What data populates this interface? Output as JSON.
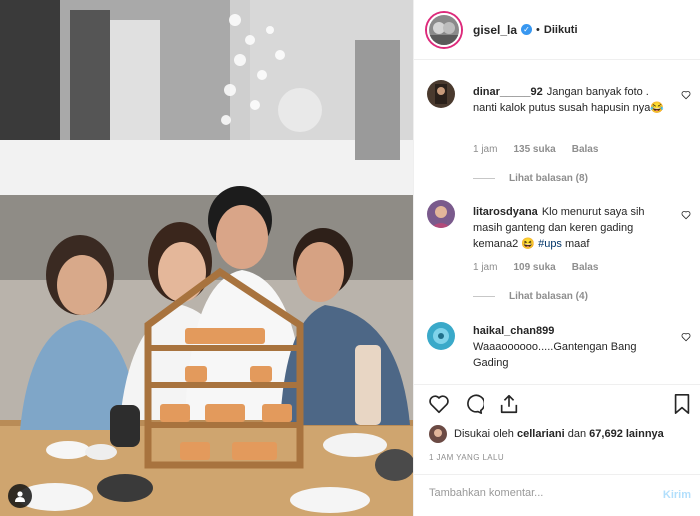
{
  "post": {
    "author": "gisel_la",
    "follow_status": "Diikuti",
    "separator": "•",
    "verified_glyph": "✓"
  },
  "comments": [
    {
      "username": "dinar_____92",
      "text": "Jangan banyak foto . nanti kalok putus susah hapusin nya😂",
      "time": "1 jam",
      "likes": "135 suka",
      "reply_label": "Balas",
      "view_replies": "Lihat balasan (8)",
      "avatar_color": "#4a3a2e"
    },
    {
      "username": "litarosdyana",
      "text_before": "Klo menurut saya sih masih ganteng dan keren gading kemana2 😆",
      "hashtag": "#ups",
      "text_after": "maaf",
      "time": "1 jam",
      "likes": "109 suka",
      "reply_label": "Balas",
      "view_replies": "Lihat balasan (4)",
      "avatar_color": "#7a5a8c"
    },
    {
      "username": "haikal_chan899",
      "text": "Waaaoooooo.....Gantengan Bang Gading",
      "avatar_color": "#3aa9c9"
    }
  ],
  "icons": {
    "like": "heart-icon",
    "comment": "comment-bubble-icon",
    "share": "share-icon",
    "save": "bookmark-icon",
    "photo_user": "user-icon"
  },
  "likes_summary": {
    "prefix": "Disukai oleh",
    "first_user": "cellariani",
    "connector": "dan",
    "count_text": "67,692 lainnya"
  },
  "timestamp": "1 JAM YANG LALU",
  "add_comment": {
    "placeholder": "Tambahkan komentar...",
    "post_label": "Kirim"
  },
  "colors": {
    "accent_blue": "#3897f0",
    "post_button_disabled": "#b2dffc",
    "ring": "#dd2a7b"
  }
}
